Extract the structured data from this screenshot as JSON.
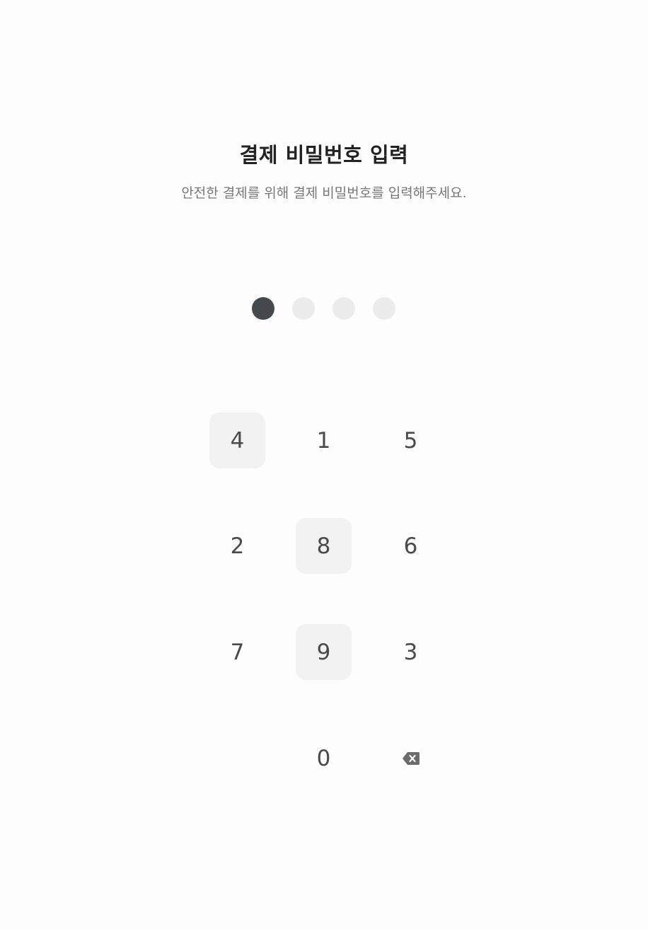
{
  "header": {
    "title": "결제 비밀번호 입력",
    "subtitle": "안전한 결제를 위해 결제 비밀번호를 입력해주세요."
  },
  "pin": {
    "length": 4,
    "entered": 1
  },
  "keypad": {
    "keys": [
      "4",
      "1",
      "5",
      "2",
      "8",
      "6",
      "7",
      "9",
      "3",
      "",
      "0",
      "backspace"
    ],
    "highlighted": [
      "4",
      "8",
      "9"
    ],
    "backspace_icon": "backspace-icon"
  },
  "colors": {
    "dot_filled": "#45484c",
    "dot_empty": "#ececec",
    "key_highlight": "#f2f2f2"
  }
}
